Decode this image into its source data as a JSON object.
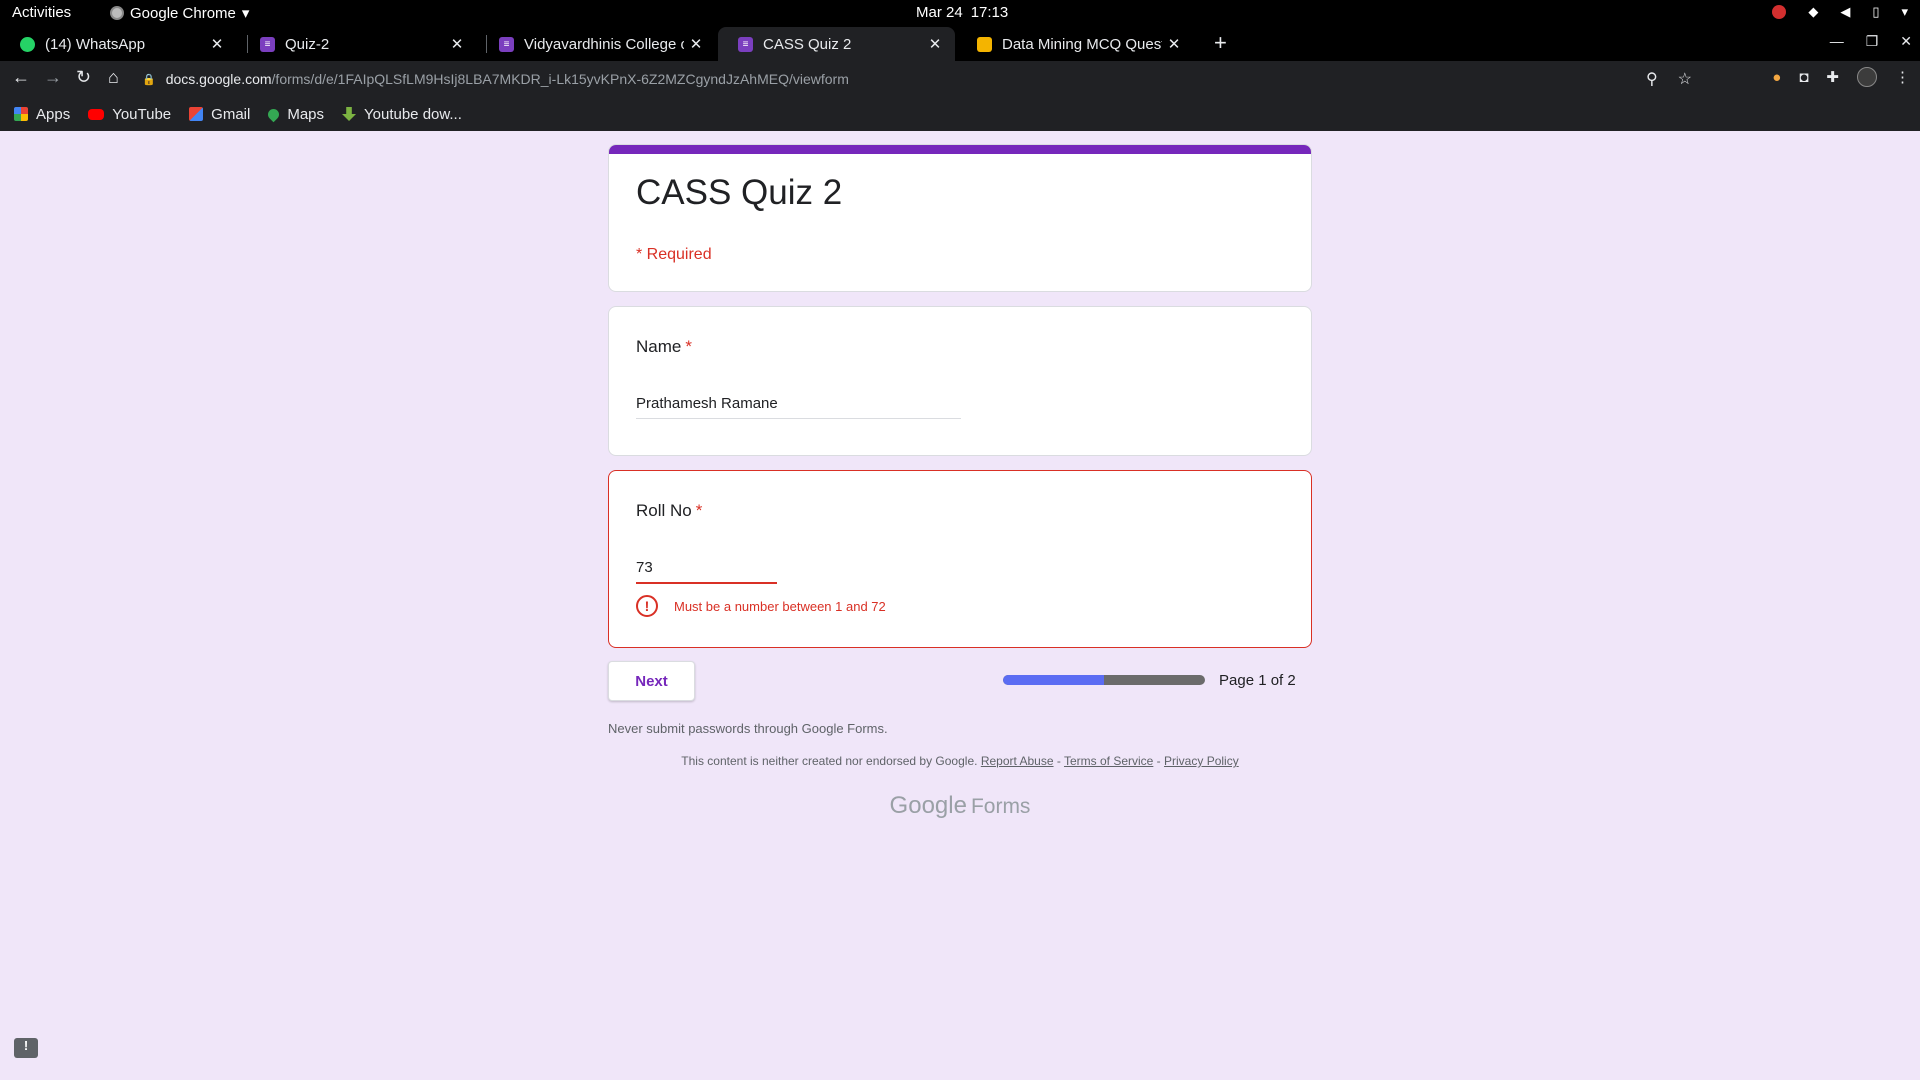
{
  "system_bar": {
    "activities": "Activities",
    "app_name": "Google Chrome",
    "date": "Mar 24",
    "time": "17:13"
  },
  "tabs": [
    {
      "title": "(14) WhatsApp",
      "icon": "whatsapp-icon"
    },
    {
      "title": "Quiz-2",
      "icon": "google-forms-icon"
    },
    {
      "title": "Vidyavardhinis College of",
      "icon": "google-forms-icon"
    },
    {
      "title": "CASS Quiz 2",
      "icon": "google-forms-icon",
      "active": true
    },
    {
      "title": "Data Mining MCQ Questio",
      "icon": "site-icon"
    }
  ],
  "address_bar": {
    "domain": "docs.google.com",
    "path": "/forms/d/e/1FAIpQLSfLM9HsIj8LBA7MKDR_i-Lk15yvKPnX-6Z2MZCgyndJzAhMEQ/viewform"
  },
  "bookmarks": [
    {
      "label": "Apps",
      "icon": "apps-grid-icon"
    },
    {
      "label": "YouTube",
      "icon": "youtube-icon"
    },
    {
      "label": "Gmail",
      "icon": "gmail-icon"
    },
    {
      "label": "Maps",
      "icon": "maps-icon"
    },
    {
      "label": "Youtube dow...",
      "icon": "download-icon"
    }
  ],
  "form": {
    "accent_color": "#7627bb",
    "title": "CASS Quiz 2",
    "required_note": "* Required",
    "questions": [
      {
        "label": "Name",
        "value": "Prathamesh Ramane"
      },
      {
        "label": "Roll No",
        "value": "73",
        "error": "Must be a number between 1 and 72"
      }
    ],
    "next_label": "Next",
    "progress_fraction": 0.5,
    "page_label": "Page 1 of 2",
    "never_submit": "Never submit passwords through Google Forms.",
    "footer_text": "This content is neither created nor endorsed by Google.",
    "report_abuse": "Report Abuse",
    "terms": "Terms of Service",
    "privacy": "Privacy Policy",
    "logo_google": "Google",
    "logo_forms": "Forms"
  }
}
